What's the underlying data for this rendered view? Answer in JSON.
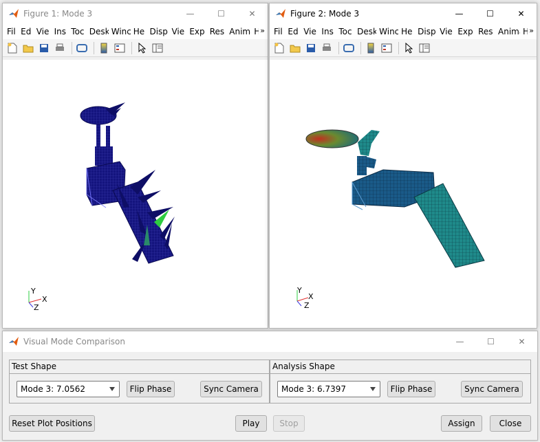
{
  "figure1": {
    "title": "Figure 1: Mode 3",
    "menus": [
      "Fil",
      "Ed",
      "Vie",
      "Ins",
      "Toc",
      "Desk",
      "Winc",
      "He",
      "Disp",
      "Vie",
      "Exp",
      "Res",
      "Anima",
      "He"
    ],
    "axes": {
      "x": "X",
      "y": "Y",
      "z": "Z"
    }
  },
  "figure2": {
    "title": "Figure 2: Mode 3",
    "menus": [
      "Fil",
      "Ed",
      "Vie",
      "Ins",
      "Toc",
      "Desk",
      "Winc",
      "He",
      "Disp",
      "Vie",
      "Exp",
      "Res",
      "Anima",
      "He"
    ],
    "axes": {
      "x": "X",
      "y": "Y",
      "z": "Z"
    }
  },
  "comparison": {
    "title": "Visual Mode Comparison",
    "test_panel": {
      "title": "Test Shape",
      "mode_value": "Mode 3: 7.0562",
      "flip_label": "Flip Phase",
      "sync_label": "Sync Camera"
    },
    "analysis_panel": {
      "title": "Analysis Shape",
      "mode_value": "Mode 3: 6.7397",
      "flip_label": "Flip Phase",
      "sync_label": "Sync Camera"
    },
    "reset_label": "Reset Plot Positions",
    "play_label": "Play",
    "stop_label": "Stop",
    "assign_label": "Assign",
    "close_label": "Close"
  },
  "colors": {
    "mesh_dark": "#10107a",
    "mesh_teal": "#1e6f8c",
    "accent_green": "#2ecc40"
  }
}
